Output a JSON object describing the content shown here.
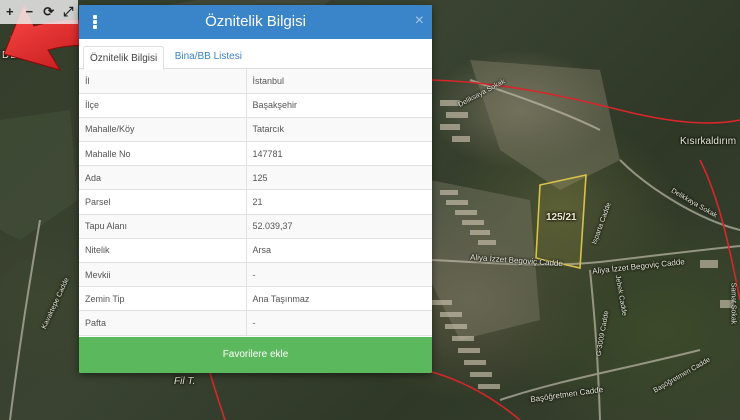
{
  "map": {
    "labels": {
      "delikli": "DELİKL",
      "kisirkaldirim": "Kısırkaldırım",
      "fil": "Fil T.",
      "aliya1": "Aliya İzzet Begoviç Cadde",
      "aliya2": "Aliya İzzet Begoviç Cadde",
      "plot": "125/21",
      "baspet": "Başöğretmen Cadde",
      "baspet2": "Başöğretmen Cadde",
      "sam": "Samat Sokak",
      "kavak": "Kavaktepe Cadde",
      "g3009": "G-3009 Cadde",
      "isparta": "Jebek Cadde",
      "deliksok": "Deliksaya Sokak",
      "jebe": "Isparta Cadde",
      "delik2": "Delikkaya Sokak"
    },
    "toolbar": {
      "zoom_in": "+",
      "zoom_out": "−",
      "refresh": "⟳",
      "fullscreen": "⤢"
    }
  },
  "dialog": {
    "title": "Öznitelik Bilgisi",
    "close": "×",
    "tabs": [
      {
        "label": "Öznitelik Bilgisi",
        "active": true
      },
      {
        "label": "Bina/BB Listesi",
        "active": false
      }
    ],
    "rows": [
      {
        "key": "İl",
        "value": "İstanbul"
      },
      {
        "key": "İlçe",
        "value": "Başakşehir"
      },
      {
        "key": "Mahalle/Köy",
        "value": "Tatarcık"
      },
      {
        "key": "Mahalle No",
        "value": "147781"
      },
      {
        "key": "Ada",
        "value": "125"
      },
      {
        "key": "Parsel",
        "value": "21"
      },
      {
        "key": "Tapu Alanı",
        "value": "52.039,37"
      },
      {
        "key": "Nitelik",
        "value": "Arsa"
      },
      {
        "key": "Mevkii",
        "value": "-"
      },
      {
        "key": "Zemin Tip",
        "value": "Ana Taşınmaz"
      },
      {
        "key": "Pafta",
        "value": "-"
      }
    ],
    "favorite_button": "Favorilere ekle"
  },
  "colors": {
    "header": "#3a84c9",
    "favorite": "#5cb85c",
    "arrow": "#e21b1b",
    "parcel_outline": "#d9c24a",
    "boundary": "#d8262a"
  }
}
